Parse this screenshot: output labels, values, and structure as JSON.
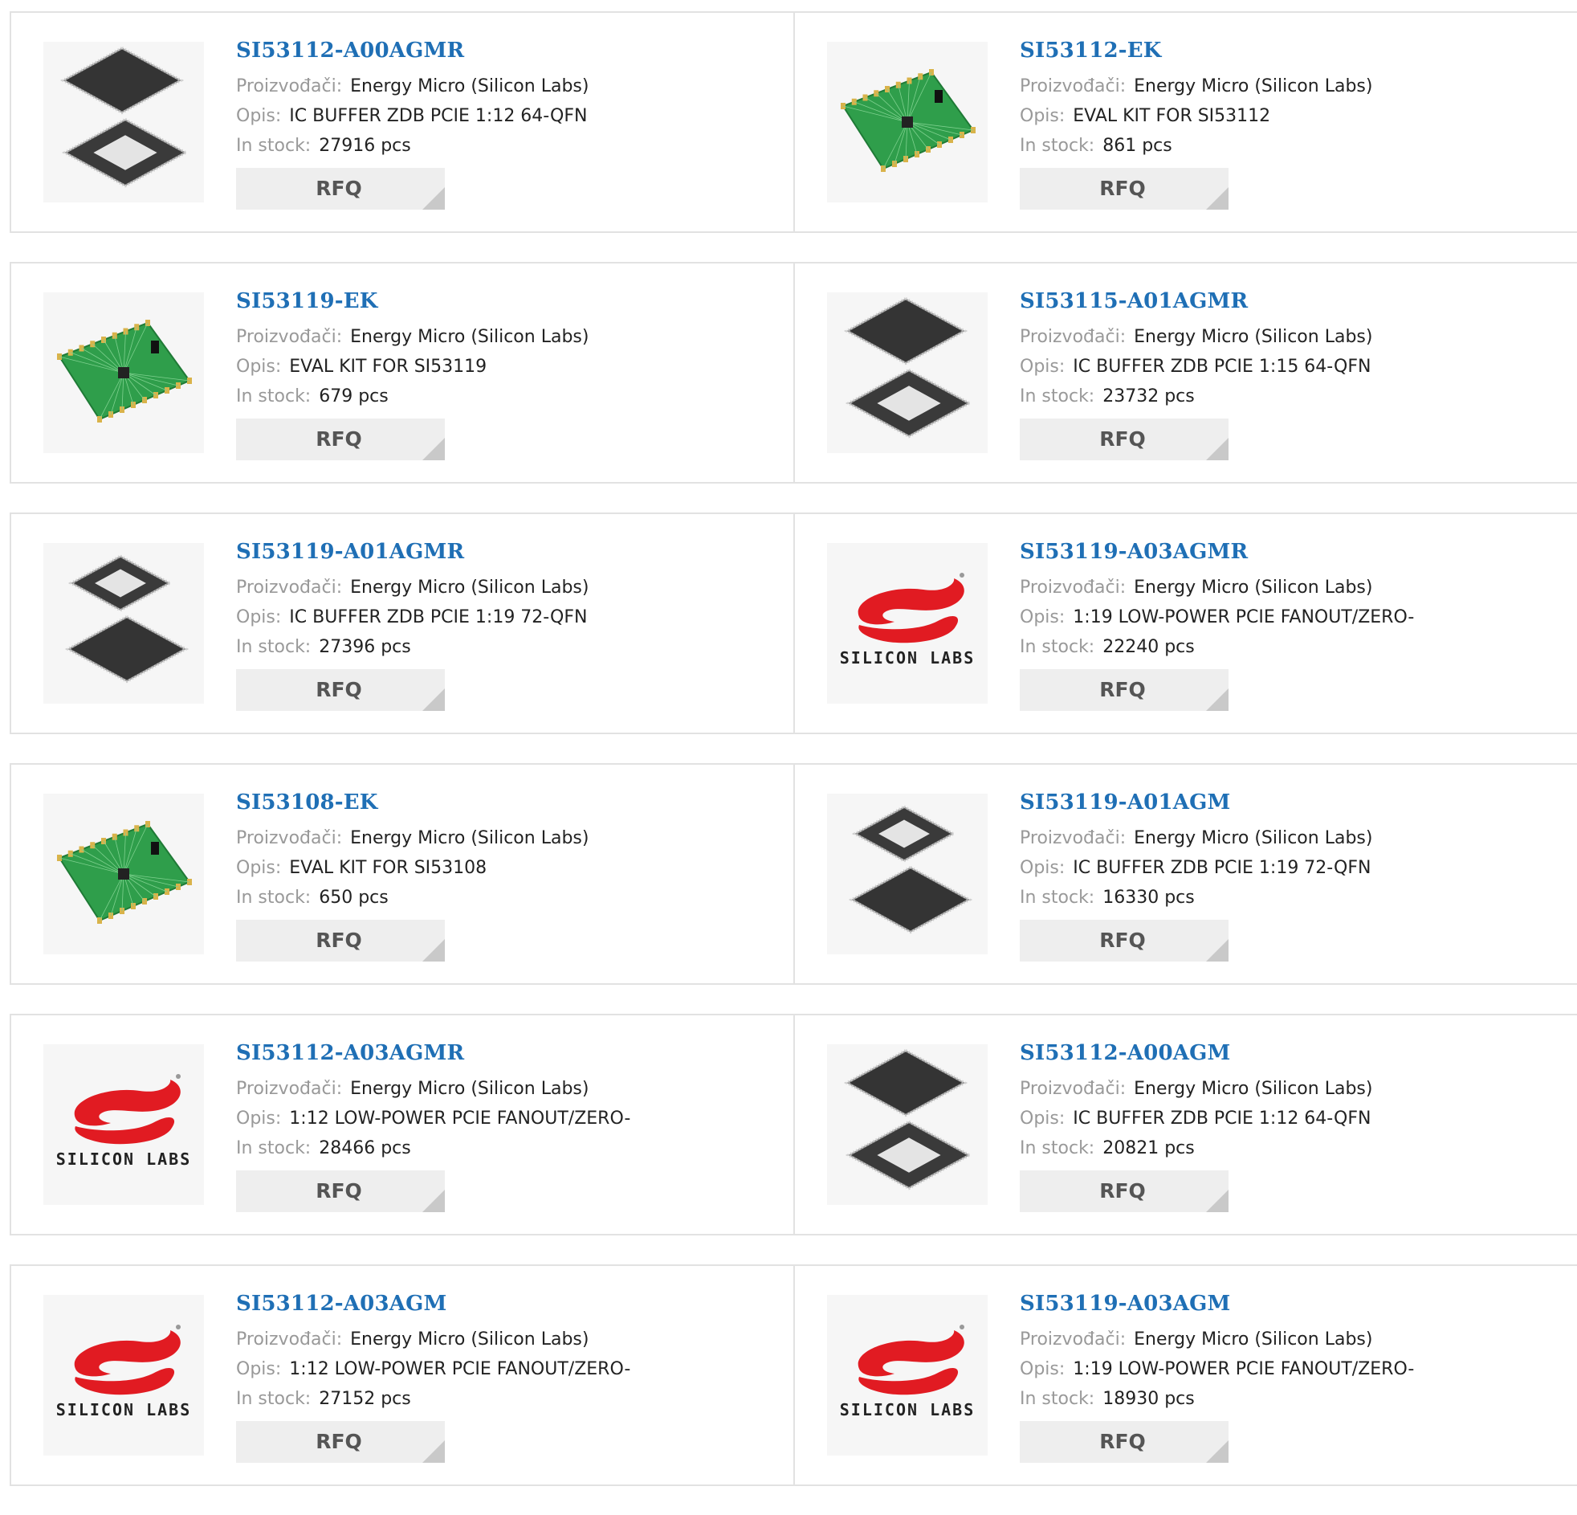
{
  "labels": {
    "manufacturer": "Proizvođači:",
    "description": "Opis:",
    "stock": "In stock:",
    "rfq": "RFQ"
  },
  "colors": {
    "link": "#1f6fb5",
    "label": "#999999",
    "border": "#e2e2e2",
    "button_bg": "#eeeeee",
    "button_corner": "#c9c9c9",
    "brand_red": "#e11b22"
  },
  "products": [
    {
      "part": "SI53112-A00AGMR",
      "manufacturer": "Energy Micro (Silicon Labs)",
      "description": "IC BUFFER ZDB PCIE 1:12 64-QFN",
      "stock": "27916 pcs",
      "image": "qfn-chip-icon"
    },
    {
      "part": "SI53112-EK",
      "manufacturer": "Energy Micro (Silicon Labs)",
      "description": "EVAL KIT FOR SI53112",
      "stock": "861 pcs",
      "image": "eval-board-icon"
    },
    {
      "part": "SI53119-EK",
      "manufacturer": "Energy Micro (Silicon Labs)",
      "description": "EVAL KIT FOR SI53119",
      "stock": "679 pcs",
      "image": "eval-board-icon"
    },
    {
      "part": "SI53115-A01AGMR",
      "manufacturer": "Energy Micro (Silicon Labs)",
      "description": "IC BUFFER ZDB PCIE 1:15 64-QFN",
      "stock": "23732 pcs",
      "image": "qfn-chip-icon"
    },
    {
      "part": "SI53119-A01AGMR",
      "manufacturer": "Energy Micro (Silicon Labs)",
      "description": "IC BUFFER ZDB PCIE 1:19 72-QFN",
      "stock": "27396 pcs",
      "image": "qfn-chip-flipped-icon"
    },
    {
      "part": "SI53119-A03AGMR",
      "manufacturer": "Energy Micro (Silicon Labs)",
      "description": "1:19 LOW-POWER PCIE FANOUT/ZERO-",
      "stock": "22240 pcs",
      "image": "silicon-labs-logo",
      "logo_text": "SILICON LABS"
    },
    {
      "part": "SI53108-EK",
      "manufacturer": "Energy Micro (Silicon Labs)",
      "description": "EVAL KIT FOR SI53108",
      "stock": "650 pcs",
      "image": "eval-board-icon"
    },
    {
      "part": "SI53119-A01AGM",
      "manufacturer": "Energy Micro (Silicon Labs)",
      "description": "IC BUFFER ZDB PCIE 1:19 72-QFN",
      "stock": "16330 pcs",
      "image": "qfn-chip-flipped-icon"
    },
    {
      "part": "SI53112-A03AGMR",
      "manufacturer": "Energy Micro (Silicon Labs)",
      "description": "1:12 LOW-POWER PCIE FANOUT/ZERO-",
      "stock": "28466 pcs",
      "image": "silicon-labs-logo",
      "logo_text": "SILICON LABS"
    },
    {
      "part": "SI53112-A00AGM",
      "manufacturer": "Energy Micro (Silicon Labs)",
      "description": "IC BUFFER ZDB PCIE 1:12 64-QFN",
      "stock": "20821 pcs",
      "image": "qfn-chip-icon"
    },
    {
      "part": "SI53112-A03AGM",
      "manufacturer": "Energy Micro (Silicon Labs)",
      "description": "1:12 LOW-POWER PCIE FANOUT/ZERO-",
      "stock": "27152 pcs",
      "image": "silicon-labs-logo",
      "logo_text": "SILICON LABS"
    },
    {
      "part": "SI53119-A03AGM",
      "manufacturer": "Energy Micro (Silicon Labs)",
      "description": "1:19 LOW-POWER PCIE FANOUT/ZERO-",
      "stock": "18930 pcs",
      "image": "silicon-labs-logo",
      "logo_text": "SILICON LABS"
    }
  ]
}
